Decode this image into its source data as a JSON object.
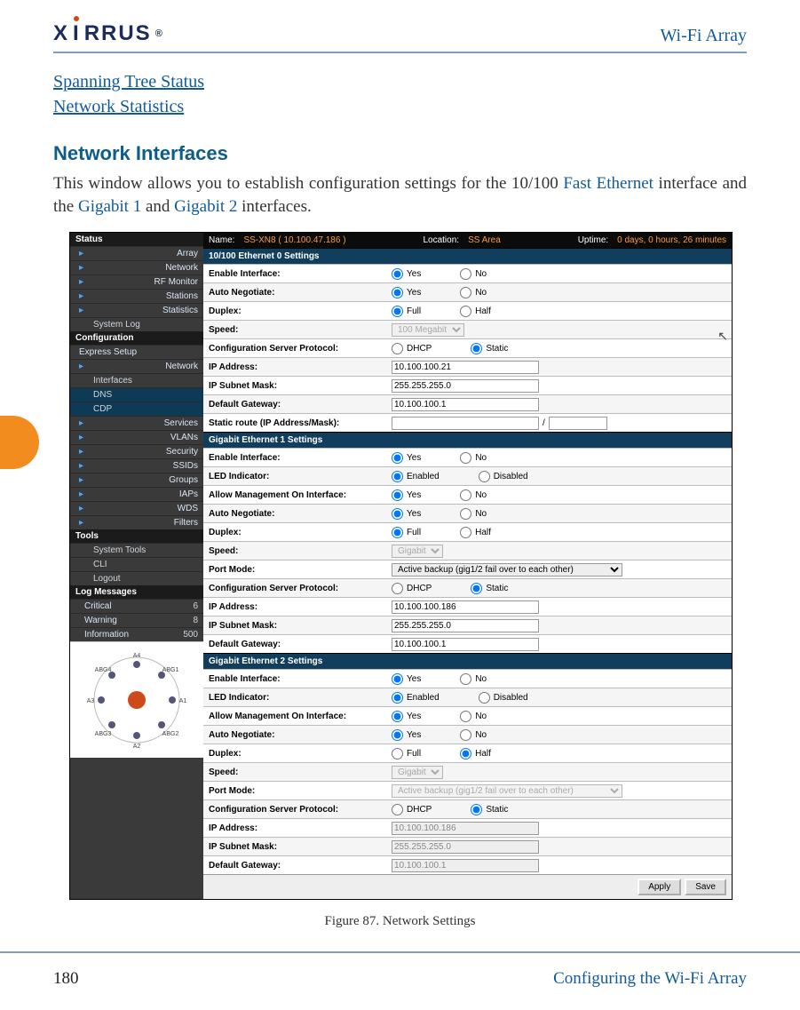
{
  "header": {
    "brand": "XIRRUS",
    "rightTitle": "Wi-Fi Array"
  },
  "tocLinks": [
    "Spanning Tree Status",
    "Network Statistics"
  ],
  "section": {
    "title": "Network Interfaces",
    "body_pre": "This window allows you to establish configuration settings for the 10/100 ",
    "glossary1": "Fast Ethernet",
    "body_mid": " interface and the ",
    "glossary2": "Gigabit 1",
    "body_and": " and ",
    "glossary3": "Gigabit 2",
    "body_post": " interfaces."
  },
  "screenshot": {
    "topbar": {
      "nameLabel": "Name:",
      "nameValue": "SS-XN8   ( 10.100.47.186 )",
      "locLabel": "Location:",
      "locValue": "SS Area",
      "upLabel": "Uptime:",
      "upValue": "0 days, 0 hours, 26 minutes"
    },
    "sidebar": {
      "statusHead": "Status",
      "status": [
        "Array",
        "Network",
        "RF Monitor",
        "Stations",
        "Statistics"
      ],
      "statusSub": [
        "System Log"
      ],
      "configHead": "Configuration",
      "config": [
        "Express Setup",
        "Network"
      ],
      "networkChildren": [
        "Interfaces",
        "DNS",
        "CDP"
      ],
      "configMore": [
        "Services",
        "VLANs",
        "Security",
        "SSIDs",
        "Groups",
        "IAPs",
        "WDS",
        "Filters"
      ],
      "toolsHead": "Tools",
      "tools": [
        "System Tools",
        "CLI",
        "Logout"
      ],
      "logHead": "Log Messages",
      "log": [
        {
          "label": "Critical",
          "count": "6"
        },
        {
          "label": "Warning",
          "count": "8"
        },
        {
          "label": "Information",
          "count": "500"
        }
      ]
    },
    "sections": [
      {
        "header": "10/100 Ethernet 0 Settings",
        "rows": [
          {
            "label": "Enable Interface:",
            "type": "radio",
            "opts": [
              "Yes",
              "No"
            ],
            "selected": 0
          },
          {
            "label": "Auto Negotiate:",
            "type": "radio",
            "opts": [
              "Yes",
              "No"
            ],
            "selected": 0
          },
          {
            "label": "Duplex:",
            "type": "radio",
            "opts": [
              "Full",
              "Half"
            ],
            "selected": 0
          },
          {
            "label": "Speed:",
            "type": "select",
            "value": "100 Megabit",
            "disabled": true
          },
          {
            "label": "Configuration Server Protocol:",
            "type": "radio",
            "opts": [
              "DHCP",
              "Static"
            ],
            "selected": 1
          },
          {
            "label": "IP Address:",
            "type": "text",
            "value": "10.100.100.21"
          },
          {
            "label": "IP Subnet Mask:",
            "type": "text",
            "value": "255.255.255.0"
          },
          {
            "label": "Default Gateway:",
            "type": "text",
            "value": "10.100.100.1"
          },
          {
            "label": "Static route (IP Address/Mask):",
            "type": "text2",
            "value": "",
            "value2": ""
          }
        ]
      },
      {
        "header": "Gigabit Ethernet 1 Settings",
        "rows": [
          {
            "label": "Enable Interface:",
            "type": "radio",
            "opts": [
              "Yes",
              "No"
            ],
            "selected": 0
          },
          {
            "label": "LED Indicator:",
            "type": "radio",
            "opts": [
              "Enabled",
              "Disabled"
            ],
            "selected": 0
          },
          {
            "label": "Allow Management On Interface:",
            "type": "radio",
            "opts": [
              "Yes",
              "No"
            ],
            "selected": 0
          },
          {
            "label": "Auto Negotiate:",
            "type": "radio",
            "opts": [
              "Yes",
              "No"
            ],
            "selected": 0
          },
          {
            "label": "Duplex:",
            "type": "radio",
            "opts": [
              "Full",
              "Half"
            ],
            "selected": 0
          },
          {
            "label": "Speed:",
            "type": "select",
            "value": "Gigabit",
            "disabled": true
          },
          {
            "label": "Port Mode:",
            "type": "select",
            "value": "Active backup (gig1/2 fail over to each other)"
          },
          {
            "label": "Configuration Server Protocol:",
            "type": "radio",
            "opts": [
              "DHCP",
              "Static"
            ],
            "selected": 1
          },
          {
            "label": "IP Address:",
            "type": "text",
            "value": "10.100.100.186"
          },
          {
            "label": "IP Subnet Mask:",
            "type": "text",
            "value": "255.255.255.0"
          },
          {
            "label": "Default Gateway:",
            "type": "text",
            "value": "10.100.100.1"
          }
        ]
      },
      {
        "header": "Gigabit Ethernet 2 Settings",
        "rows": [
          {
            "label": "Enable Interface:",
            "type": "radio",
            "opts": [
              "Yes",
              "No"
            ],
            "selected": 0
          },
          {
            "label": "LED Indicator:",
            "type": "radio",
            "opts": [
              "Enabled",
              "Disabled"
            ],
            "selected": 0
          },
          {
            "label": "Allow Management On Interface:",
            "type": "radio",
            "opts": [
              "Yes",
              "No"
            ],
            "selected": 0
          },
          {
            "label": "Auto Negotiate:",
            "type": "radio",
            "opts": [
              "Yes",
              "No"
            ],
            "selected": 0
          },
          {
            "label": "Duplex:",
            "type": "radio",
            "opts": [
              "Full",
              "Half"
            ],
            "selected": 1
          },
          {
            "label": "Speed:",
            "type": "select",
            "value": "Gigabit",
            "disabled": true
          },
          {
            "label": "Port Mode:",
            "type": "select",
            "value": "Active backup (gig1/2 fail over to each other)",
            "disabled": true
          },
          {
            "label": "Configuration Server Protocol:",
            "type": "radio",
            "opts": [
              "DHCP",
              "Static"
            ],
            "selected": 1
          },
          {
            "label": "IP Address:",
            "type": "text",
            "value": "10.100.100.186",
            "disabled": true
          },
          {
            "label": "IP Subnet Mask:",
            "type": "text",
            "value": "255.255.255.0",
            "disabled": true
          },
          {
            "label": "Default Gateway:",
            "type": "text",
            "value": "10.100.100.1",
            "disabled": true
          }
        ]
      }
    ],
    "buttons": {
      "apply": "Apply",
      "save": "Save"
    },
    "diagram": {
      "labels": [
        "A4",
        "ABG4",
        "ABG1",
        "A3",
        "A1",
        "ABG3",
        "ABG2",
        "A2"
      ]
    }
  },
  "figureCaption": "Figure 87. Network Settings",
  "footer": {
    "pageNum": "180",
    "chapter": "Configuring the Wi-Fi Array"
  }
}
